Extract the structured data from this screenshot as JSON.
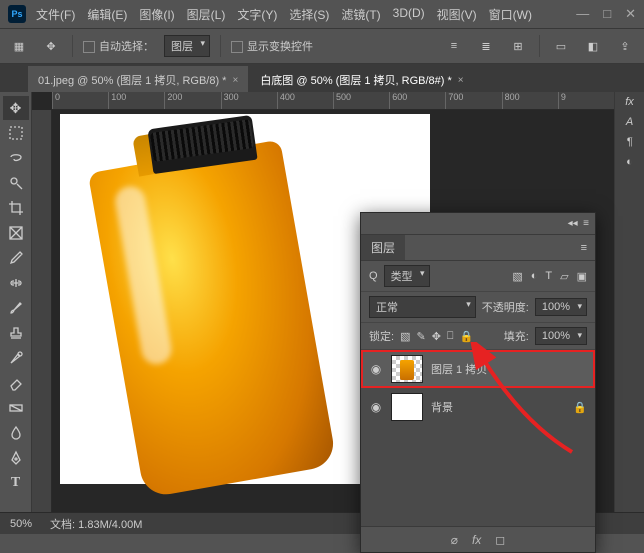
{
  "titlebar": {
    "logo": "Ps"
  },
  "menu": {
    "file": "文件(F)",
    "edit": "编辑(E)",
    "image": "图像(I)",
    "layer": "图层(L)",
    "type": "文字(Y)",
    "select": "选择(S)",
    "filter": "滤镜(T)",
    "threeD": "3D(D)",
    "view": "视图(V)",
    "window": "窗口(W)"
  },
  "optbar": {
    "auto_select": "自动选择：",
    "target": "图层",
    "show_transform": "显示变换控件"
  },
  "tabs": {
    "t1": "01.jpeg @ 50% (图层 1 拷贝, RGB/8) *",
    "t2": "白底图 @ 50% (图层 1 拷贝, RGB/8#) *"
  },
  "ruler": {
    "m0": "0",
    "m1": "100",
    "m2": "200",
    "m3": "300",
    "m4": "400",
    "m5": "500",
    "m6": "600",
    "m7": "700",
    "m8": "800",
    "m9": "9"
  },
  "panel": {
    "title": "图层",
    "kind_label": "类型",
    "blend": "正常",
    "opacity_label": "不透明度:",
    "opacity_val": "100%",
    "lock_label": "锁定:",
    "fill_label": "填充:",
    "fill_val": "100%",
    "search_prefix": "Q"
  },
  "layers": {
    "l1": "图层 1 拷贝",
    "l2": "背景"
  },
  "status": {
    "zoom": "50%",
    "doc_label": "文档:",
    "doc_size": "1.83M/4.00M"
  }
}
